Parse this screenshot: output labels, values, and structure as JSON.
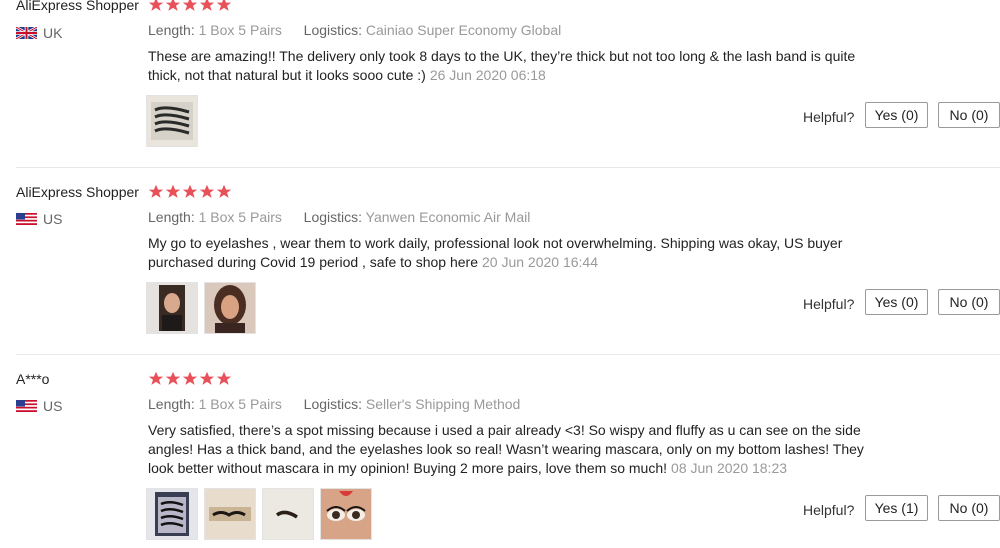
{
  "labels": {
    "length": "Length:",
    "logistics": "Logistics:",
    "helpful": "Helpful?"
  },
  "colors": {
    "star": "#e8515a",
    "divider": "#e8e8e8"
  },
  "reviews": [
    {
      "author": "AliExpress Shopper",
      "country": "UK",
      "flag": "uk-flag-icon",
      "rating": 5,
      "length": "1 Box 5 Pairs",
      "logistics": "Cainiao Super Economy Global",
      "text": "These are amazing!! The delivery only took 8 days to the UK, they’re thick but not too long & the lash band is quite thick, not that natural but it looks sooo cute :)",
      "date": "26 Jun 2020 06:18",
      "photos": [
        "lash-box-photo"
      ],
      "yes": "Yes (0)",
      "no": "No (0)"
    },
    {
      "author": "AliExpress Shopper",
      "country": "US",
      "flag": "us-flag-icon",
      "rating": 5,
      "length": "1 Box 5 Pairs",
      "logistics": "Yanwen Economic Air Mail",
      "text": "My go to eyelashes , wear them to work daily, professional look not overwhelming. Shipping was okay, US buyer purchased during Covid 19 period , safe to shop here",
      "date": "20 Jun 2020 16:44",
      "photos": [
        "selfie-photo-1",
        "selfie-photo-2"
      ],
      "yes": "Yes (0)",
      "no": "No (0)"
    },
    {
      "author": "A***o",
      "country": "US",
      "flag": "us-flag-icon",
      "rating": 5,
      "length": "1 Box 5 Pairs",
      "logistics": "Seller's Shipping Method",
      "text": "Very satisfied, there’s a spot missing because i used a pair already <3! So wispy and fluffy as u can see on the side angles! Has a thick band, and the eyelashes look so real! Wasn’t wearing mascara, only on my bottom lashes! They look better without mascara in my opinion! Buying 2 more pairs, love them so much!",
      "date": "08 Jun 2020 18:23",
      "photos": [
        "lash-box-photo",
        "lash-strip-photo",
        "lash-closeup-photo",
        "eye-makeup-photo"
      ],
      "yes": "Yes (1)",
      "no": "No (0)"
    }
  ]
}
